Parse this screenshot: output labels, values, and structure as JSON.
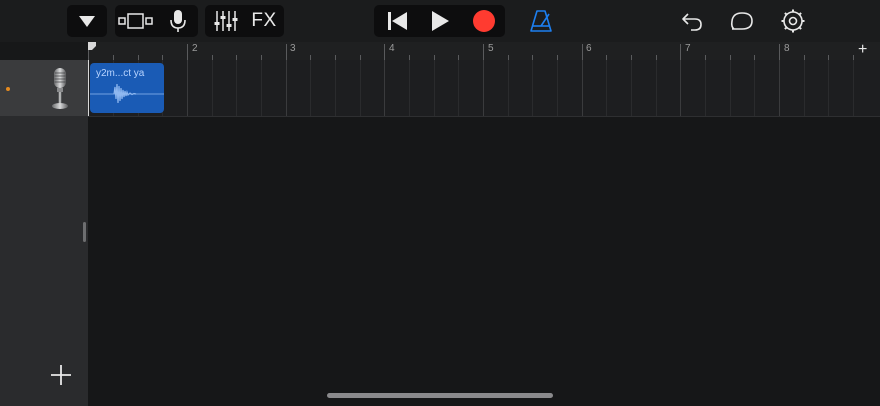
{
  "toolbar": {
    "fx_label": "FX",
    "accent_color": "#1d7ff0",
    "record_color": "#ff3b30"
  },
  "ruler": {
    "bars": [
      "2",
      "3",
      "4",
      "5",
      "6",
      "7",
      "8"
    ],
    "add_label": "+"
  },
  "tracks": [
    {
      "name_icon": "microphone-icon",
      "region": {
        "title": "y2m...ct ya",
        "color": "#1a5bb5"
      }
    }
  ],
  "icons": {
    "menu": "triangle-down-icon",
    "view": "tracks-view-icon",
    "mic": "microphone-icon",
    "mixer": "mixer-icon",
    "rewind": "go-to-beginning-icon",
    "play": "play-icon",
    "record": "record-icon",
    "metronome": "metronome-icon",
    "undo": "undo-icon",
    "loop": "loop-browser-icon",
    "settings": "settings-icon",
    "add_track": "plus-icon"
  }
}
